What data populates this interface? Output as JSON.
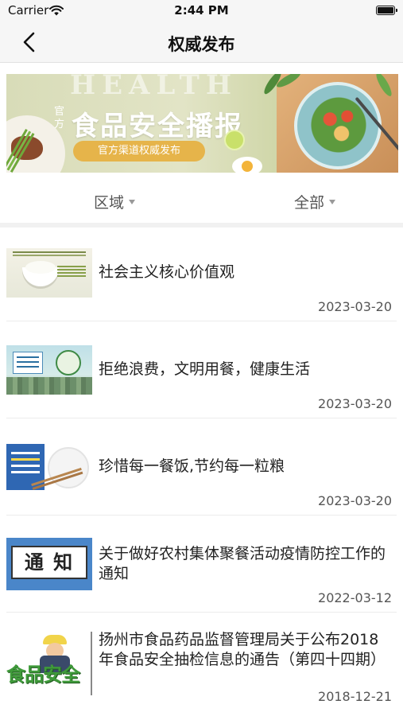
{
  "status_bar": {
    "carrier": "Carrier",
    "time": "2:44 PM"
  },
  "nav": {
    "title": "权威发布",
    "back_icon": "chevron-left-icon"
  },
  "banner": {
    "watermark": "HEALTH",
    "badge": "官方",
    "title": "食品安全播报",
    "subtitle": "官方渠道权威发布"
  },
  "filters": {
    "region": {
      "label": "区域",
      "icon": "caret-down-icon"
    },
    "category": {
      "label": "全部",
      "icon": "caret-down-icon"
    }
  },
  "articles": [
    {
      "title": "社会主义核心价值观",
      "date": "2023-03-20"
    },
    {
      "title": "拒绝浪费，文明用餐，健康生活",
      "date": "2023-03-20"
    },
    {
      "title": "珍惜每一餐饭,节约每一粒粮",
      "date": "2023-03-20"
    },
    {
      "title": "关于做好农村集体聚餐活动疫情防控工作的通知",
      "date": "2022-03-12",
      "thumb_text": "通 知"
    },
    {
      "title": "扬州市食品药品监督管理局关于公布2018年食品安全抽检信息的通告（第四十四期）",
      "date": "2018-12-21",
      "thumb_text": "食品安全"
    }
  ]
}
